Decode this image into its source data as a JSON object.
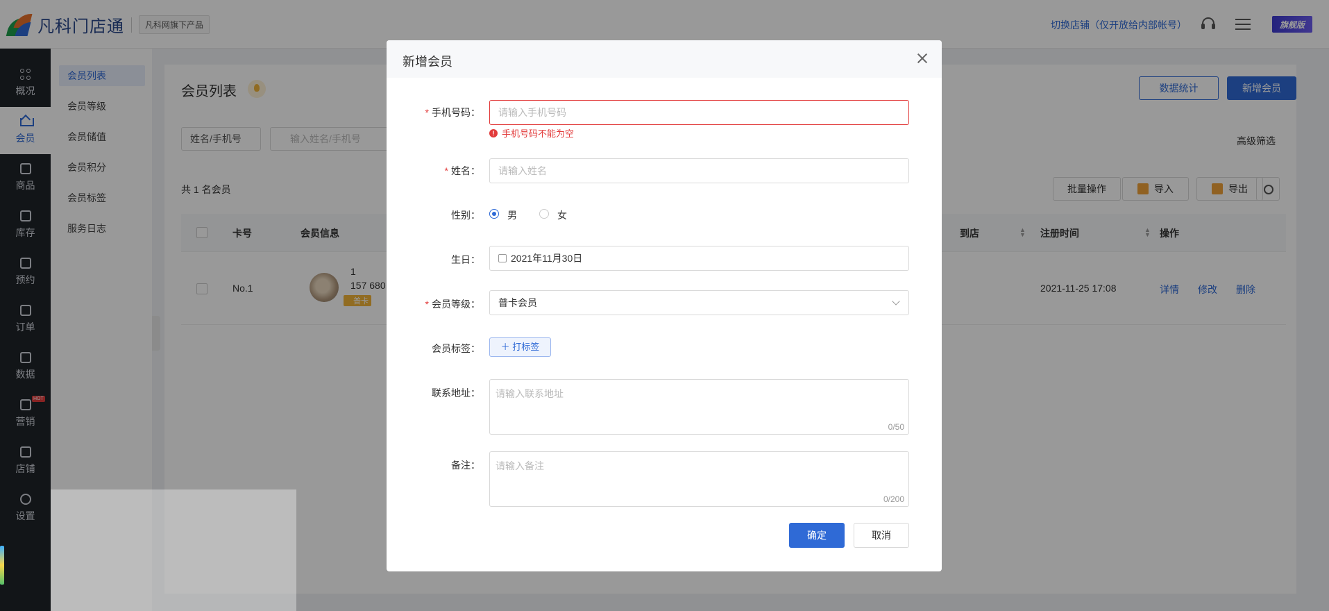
{
  "header": {
    "brand": "凡科门店通",
    "brand_tag": "凡科网旗下产品",
    "switch_store": "切换店铺（仅开放给内部帐号）",
    "vip_badge": "旗舰版"
  },
  "leftnav": {
    "items": [
      {
        "label": "概况",
        "icon": "dashboard-icon"
      },
      {
        "label": "会员",
        "icon": "crown-icon",
        "active": true
      },
      {
        "label": "商品",
        "icon": "box-icon"
      },
      {
        "label": "库存",
        "icon": "warehouse-icon"
      },
      {
        "label": "预约",
        "icon": "calendar-check-icon"
      },
      {
        "label": "订单",
        "icon": "order-icon"
      },
      {
        "label": "数据",
        "icon": "data-icon"
      },
      {
        "label": "营销",
        "icon": "marketing-icon",
        "badge": "HOT"
      },
      {
        "label": "店铺",
        "icon": "store-icon"
      },
      {
        "label": "设置",
        "icon": "settings-icon"
      }
    ]
  },
  "subnav": {
    "items": [
      "会员列表",
      "会员等级",
      "会员储值",
      "会员积分",
      "会员标签",
      "服务日志"
    ],
    "active": "会员列表"
  },
  "main": {
    "title": "会员列表",
    "stats_button": "数据统计",
    "add_button": "新增会员",
    "filter_select": "姓名/手机号",
    "search_placeholder": "输入姓名/手机号",
    "advanced_filter": "高级筛选",
    "count_text": "共 1 名会员",
    "batch_button": "批量操作",
    "import_button": "导入",
    "export_button": "导出",
    "table": {
      "columns": [
        "卡号",
        "会员信息",
        "到店",
        "注册时间",
        "操作"
      ],
      "rows": [
        {
          "card_no": "No.1",
          "name": "1",
          "phone": "157 680",
          "level": "普卡",
          "register_time": "2021-11-25 17:08",
          "actions": [
            "详情",
            "修改",
            "删除"
          ]
        }
      ]
    }
  },
  "modal": {
    "title": "新增会员",
    "fields": {
      "phone": {
        "label": "手机号码：",
        "placeholder": "请输入手机号码",
        "error": "手机号码不能为空"
      },
      "name": {
        "label": "姓名：",
        "placeholder": "请输入姓名"
      },
      "gender": {
        "label": "性别：",
        "options": [
          "男",
          "女"
        ],
        "selected": "男"
      },
      "birthday": {
        "label": "生日：",
        "value": "2021年11月30日"
      },
      "level": {
        "label": "会员等级：",
        "value": "普卡会员"
      },
      "tags": {
        "label": "会员标签：",
        "button": "打标签"
      },
      "address": {
        "label": "联系地址：",
        "placeholder": "请输入联系地址",
        "counter": "0/50"
      },
      "remark": {
        "label": "备注：",
        "placeholder": "请输入备注",
        "counter": "0/200"
      }
    },
    "confirm": "确定",
    "cancel": "取消"
  },
  "colors": {
    "primary": "#2f6ad6",
    "error": "#e23b3b",
    "nav_bg": "#1f2329"
  }
}
